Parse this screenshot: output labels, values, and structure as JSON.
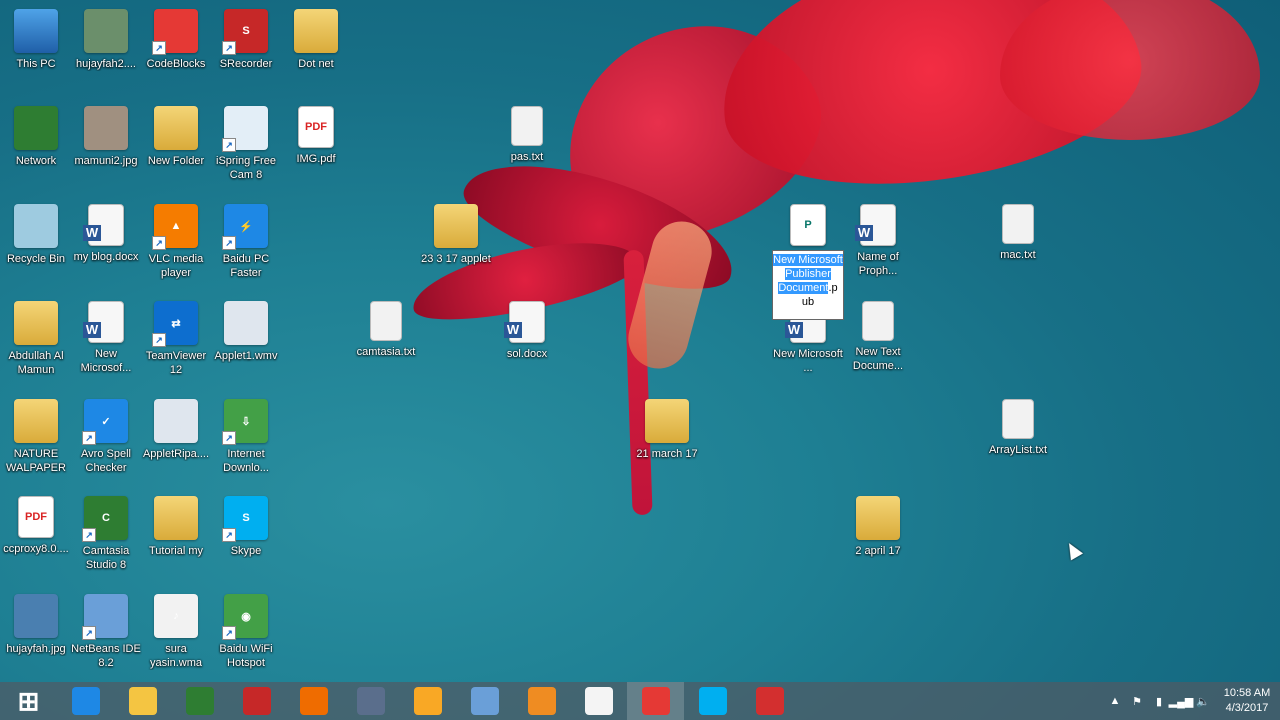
{
  "desktop": {
    "icons": [
      {
        "label": "This PC"
      },
      {
        "label": "hujayfah2...."
      },
      {
        "label": "CodeBlocks"
      },
      {
        "label": "SRecorder"
      },
      {
        "label": "Dot net"
      },
      {
        "label": "Network"
      },
      {
        "label": "mamuni2.jpg"
      },
      {
        "label": "New Folder"
      },
      {
        "label": "iSpring Free Cam 8"
      },
      {
        "label": "IMG.pdf"
      },
      {
        "label": "Recycle Bin"
      },
      {
        "label": "my blog.docx"
      },
      {
        "label": "VLC media player"
      },
      {
        "label": "Baidu PC Faster"
      },
      {
        "label": "Abdullah Al Mamun"
      },
      {
        "label": "New Microsof..."
      },
      {
        "label": "TeamViewer 12"
      },
      {
        "label": "Applet1.wmv"
      },
      {
        "label": "NATURE WALPAPER"
      },
      {
        "label": "Avro Spell Checker"
      },
      {
        "label": "AppletRipa...."
      },
      {
        "label": "Internet Downlo..."
      },
      {
        "label": "ccproxy8.0...."
      },
      {
        "label": "Camtasia Studio 8"
      },
      {
        "label": "Tutorial my"
      },
      {
        "label": "Skype"
      },
      {
        "label": "hujayfah.jpg"
      },
      {
        "label": "NetBeans IDE 8.2"
      },
      {
        "label": "sura yasin.wma"
      },
      {
        "label": "Baidu WiFi Hotspot"
      },
      {
        "label": "pas.txt"
      },
      {
        "label": "23 3 17 applet"
      },
      {
        "label": "camtasia.txt"
      },
      {
        "label": "sol.docx"
      },
      {
        "label": "Name of Proph..."
      },
      {
        "label": "mac.txt"
      },
      {
        "label": "New Microsoft ..."
      },
      {
        "label": "New Text Docume..."
      },
      {
        "label": "21 march 17"
      },
      {
        "label": "ArrayList.txt"
      },
      {
        "label": "2 april 17"
      }
    ],
    "rename": {
      "selected_text": "New Microsoft Publisher Document",
      "extension_text": ".p",
      "extension_tail": "ub"
    }
  },
  "taskbar": {
    "apps": [
      {
        "icon": "windows-start-icon",
        "label": "Start"
      },
      {
        "icon": "internet-explorer-icon",
        "label": "e"
      },
      {
        "icon": "file-explorer-icon",
        "label": "Files"
      },
      {
        "icon": "windows-store-icon",
        "label": "Store"
      },
      {
        "icon": "download-manager-icon",
        "label": "IDM"
      },
      {
        "icon": "firefox-icon",
        "label": "Firefox"
      },
      {
        "icon": "text-editor-icon",
        "label": "T"
      },
      {
        "icon": "media-player-icon",
        "label": "Media"
      },
      {
        "icon": "netbeans-icon",
        "label": "NetBeans"
      },
      {
        "icon": "slides-icon",
        "label": "Slides"
      },
      {
        "icon": "chrome-icon",
        "label": "Chrome"
      },
      {
        "icon": "baidu-icon",
        "label": "Baidu"
      },
      {
        "icon": "skype-icon",
        "label": "S"
      },
      {
        "icon": "codeblocks-icon",
        "label": "CB"
      }
    ],
    "clock": {
      "time": "10:58 AM",
      "date": "4/3/2017"
    }
  }
}
